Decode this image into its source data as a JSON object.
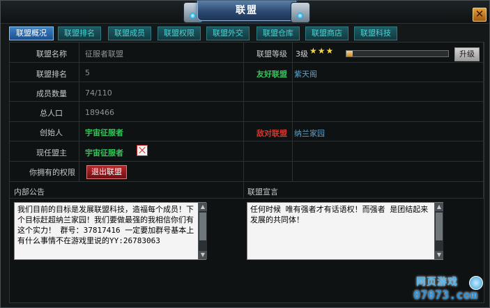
{
  "window": {
    "title": "联盟",
    "close_label": "✕"
  },
  "tabs": [
    {
      "label": "联盟概况",
      "active": true
    },
    {
      "label": "联盟排名",
      "active": false
    },
    {
      "label": "联盟成员",
      "active": false
    },
    {
      "label": "联盟权限",
      "active": false
    },
    {
      "label": "联盟外交",
      "active": false
    },
    {
      "label": "联盟仓库",
      "active": false
    },
    {
      "label": "联盟商店",
      "active": false
    },
    {
      "label": "联盟科技",
      "active": false
    }
  ],
  "info": {
    "name_label": "联盟名称",
    "name_value": "征服者联盟",
    "rank_label": "联盟排名",
    "rank_value": "5",
    "members_label": "成员数量",
    "members_value": "74/110",
    "population_label": "总人口",
    "population_value": "189466",
    "founder_label": "创始人",
    "founder_value": "宇宙征服者",
    "leader_label": "现任盟主",
    "leader_value": "宇宙征服者",
    "permission_label": "你拥有的权限",
    "quit_button": "退出联盟",
    "level_label": "联盟等级",
    "level_value": "3级",
    "level_stars": 3,
    "level_progress": 0.06,
    "upgrade_button": "升级",
    "friend_label": "友好联盟",
    "friend_value": "紫天阁",
    "enemy_label": "敌对联盟",
    "enemy_value": "纳兰家园"
  },
  "notice": {
    "internal_label": "内部公告",
    "internal_text": "我们目前的目标是发展联盟科技，造福每个成员！下个目标赶超纳兰家园！我们要做最强的我相信你们有这个实力！ 群号：37817416 一定要加群号基本上有什么事情不在游戏里说的YY:26783063",
    "declaration_label": "联盟宣言",
    "declaration_text": "任何时候 唯有强者才有话语权！而强者 是团结起来发展的共同体！"
  },
  "watermark": {
    "line1": "网页游戏",
    "line2": "07073.com"
  },
  "colors": {
    "accent": "#36c35b",
    "enemy": "#d9352b",
    "friend_value": "#5fa0c8",
    "tab_active": "#2d6fb5",
    "tab_text": "#4cd1d1"
  }
}
